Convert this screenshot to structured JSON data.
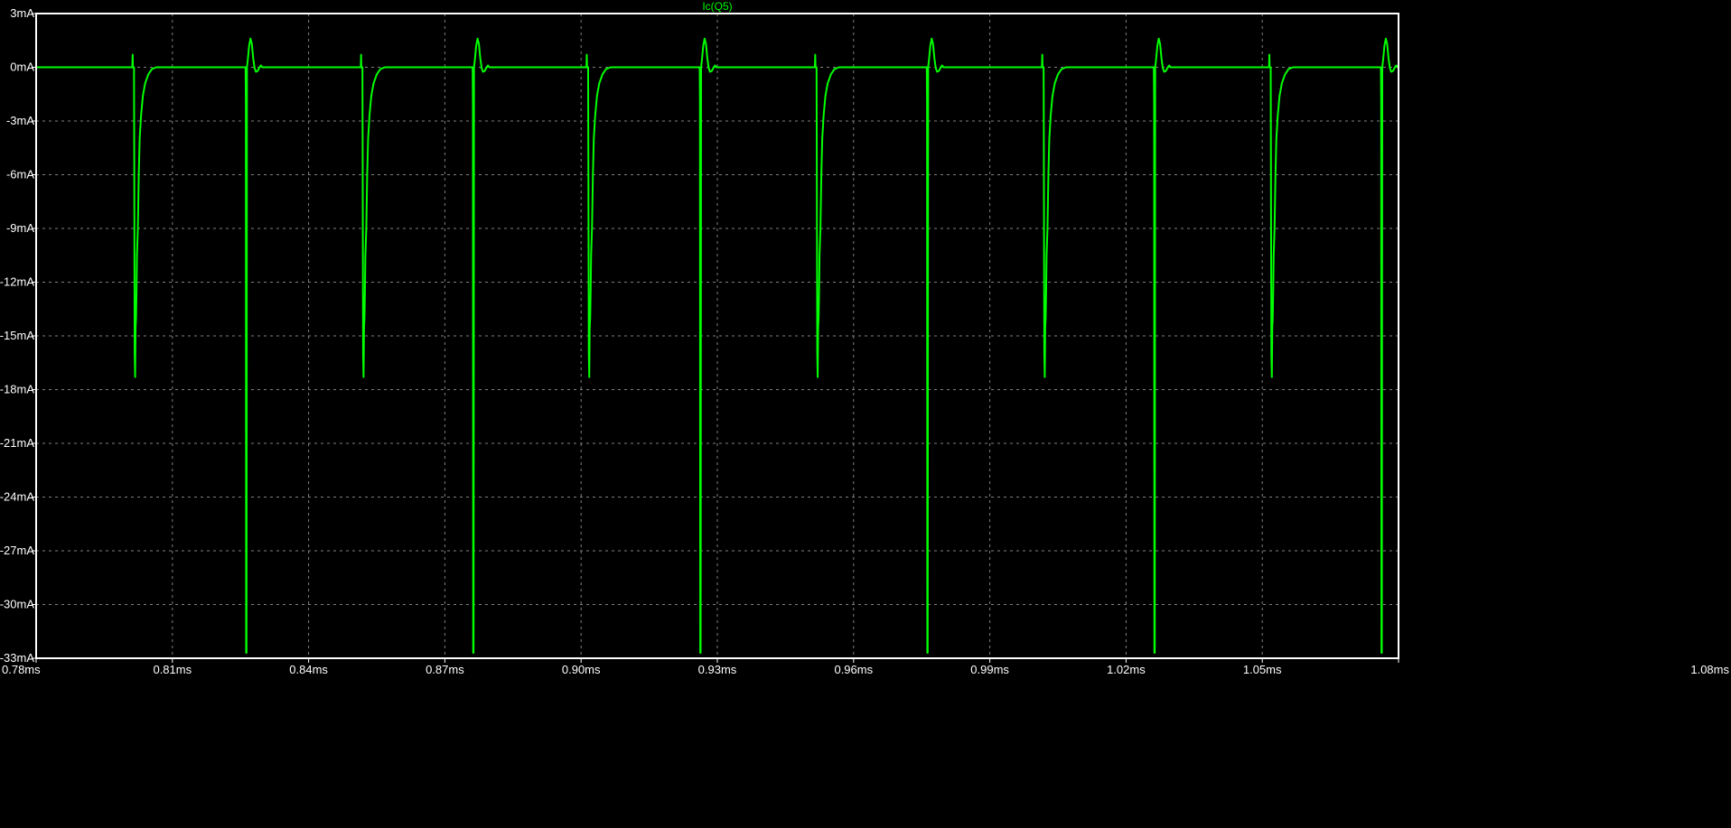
{
  "window": {
    "background": "#000000"
  },
  "chart_data": {
    "type": "line",
    "title": "Ic(Q5)",
    "xlabel": "",
    "ylabel": "",
    "xlim": [
      0.78,
      1.08
    ],
    "ylim": [
      -33,
      3
    ],
    "x_unit": "ms",
    "y_unit": "mA",
    "x_ticks": [
      "0.78ms",
      "0.81ms",
      "0.84ms",
      "0.87ms",
      "0.90ms",
      "0.93ms",
      "0.96ms",
      "0.99ms",
      "1.02ms",
      "1.05ms",
      "1.08ms"
    ],
    "y_ticks": [
      "3mA",
      "0mA",
      "-3mA",
      "-6mA",
      "-9mA",
      "-12mA",
      "-15mA",
      "-18mA",
      "-21mA",
      "-24mA",
      "-27mA",
      "-30mA",
      "-33mA"
    ],
    "grid": true,
    "colors": {
      "series": "#00ff00",
      "frame": "#ffffff",
      "grid": "#808080",
      "text": "#ffffff",
      "background": "#000000"
    },
    "series": [
      {
        "name": "Ic(Q5)",
        "period_ms": 0.05,
        "baseline_mA": 0,
        "pulses": [
          {
            "t_ms": 0.8017,
            "min_mA": -17.3,
            "pre_spike_mA": 0.7
          },
          {
            "t_ms": 0.852,
            "min_mA": -17.3,
            "pre_spike_mA": 0.7
          },
          {
            "t_ms": 0.9017,
            "min_mA": -17.3,
            "pre_spike_mA": 0.7
          },
          {
            "t_ms": 0.952,
            "min_mA": -17.3,
            "pre_spike_mA": 0.7
          },
          {
            "t_ms": 1.002,
            "min_mA": -17.3,
            "pre_spike_mA": 0.7
          },
          {
            "t_ms": 1.052,
            "min_mA": -17.3,
            "pre_spike_mA": 0.7
          }
        ],
        "spikes": [
          {
            "t_ms": 0.8263,
            "min_mA": -32.7,
            "peak_mA": 1.6
          },
          {
            "t_ms": 0.8763,
            "min_mA": -32.7,
            "peak_mA": 1.6
          },
          {
            "t_ms": 0.9263,
            "min_mA": -32.7,
            "peak_mA": 1.6
          },
          {
            "t_ms": 0.9763,
            "min_mA": -32.7,
            "peak_mA": 1.6
          },
          {
            "t_ms": 1.0263,
            "min_mA": -32.7,
            "peak_mA": 1.6
          },
          {
            "t_ms": 1.0763,
            "min_mA": -32.7,
            "peak_mA": 1.6
          }
        ]
      }
    ]
  }
}
